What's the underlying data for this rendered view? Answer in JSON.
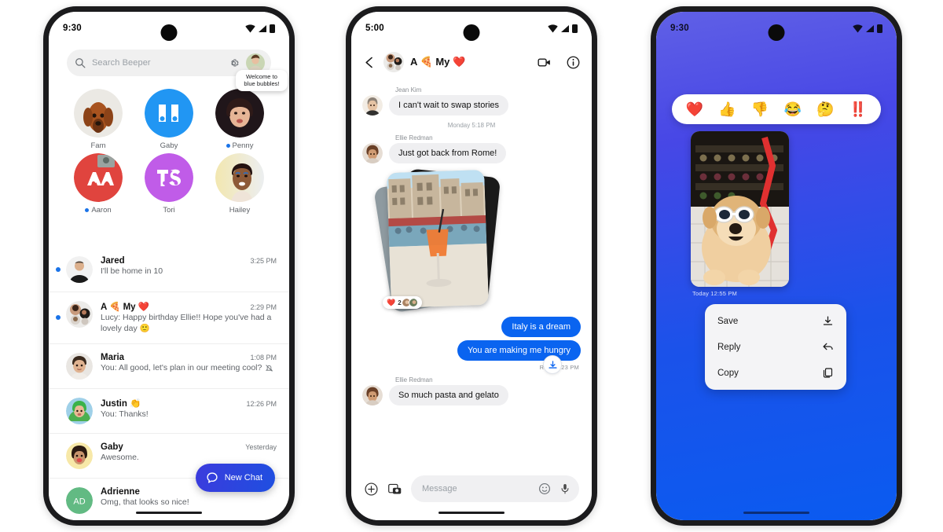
{
  "phone1": {
    "status": {
      "time": "9:30"
    },
    "search": {
      "placeholder": "Search Beeper",
      "icon": "search-icon",
      "settings_icon": "gear-icon"
    },
    "tooltip": "Welcome to blue bubbles!",
    "avatars": [
      {
        "name": "Fam",
        "unread": false
      },
      {
        "name": "Gaby",
        "unread": false
      },
      {
        "name": "Penny",
        "unread": true
      },
      {
        "name": "Aaron",
        "unread": true
      },
      {
        "name": "Tori",
        "unread": false
      },
      {
        "name": "Hailey",
        "unread": false
      }
    ],
    "chats": [
      {
        "name": "Jared",
        "preview": "I'll be home in 10",
        "time": "3:25 PM",
        "unread": true,
        "muted": false
      },
      {
        "name": "A 🍕 My ❤️",
        "preview": "Lucy: Happy birthday Ellie!! Hope you've had a lovely day  🙂",
        "time": "2:29 PM",
        "unread": true,
        "muted": false
      },
      {
        "name": "Maria",
        "preview": "You: All good, let's plan in our meeting cool?",
        "time": "1:08 PM",
        "unread": false,
        "muted": true
      },
      {
        "name": "Justin 👏",
        "preview": "You: Thanks!",
        "time": "12:26 PM",
        "unread": false,
        "muted": false
      },
      {
        "name": "Gaby",
        "preview": "Awesome.",
        "time": "Yesterday",
        "unread": false,
        "muted": false
      },
      {
        "name": "Adrienne",
        "preview": "Omg, that looks so nice!",
        "time": "",
        "unread": false,
        "muted": false,
        "initials": "AD"
      }
    ],
    "new_chat": {
      "label": "New Chat",
      "icon": "chat-bubble-icon",
      "color": "#2b3fe0"
    }
  },
  "phone2": {
    "status": {
      "time": "5:00"
    },
    "header": {
      "back_icon": "back-arrow-icon",
      "title": "A 🍕 My ❤️",
      "video_icon": "video-call-icon",
      "info_icon": "info-icon"
    },
    "messages": [
      {
        "type": "incoming",
        "sender": "Jean Kim",
        "text": "I can't wait to swap stories"
      },
      {
        "type": "daystamp",
        "text": "Monday 5:18 PM"
      },
      {
        "type": "incoming",
        "sender": "Ellie Redman",
        "text": "Just got back from Rome!"
      },
      {
        "type": "photo-stack",
        "reaction": "❤️",
        "reaction_count": "2",
        "download_icon": "download-icon"
      },
      {
        "type": "outgoing",
        "text": "Italy is a dream"
      },
      {
        "type": "outgoing",
        "text": "You are making me hungry",
        "receipt": "Read  5:23 PM"
      },
      {
        "type": "incoming",
        "sender": "Ellie Redman",
        "text": "So much pasta and gelato"
      }
    ],
    "composer": {
      "placeholder": "Message",
      "plus_icon": "plus-circle-icon",
      "gallery_icon": "gallery-icon",
      "emoji_icon": "emoji-icon",
      "mic_icon": "microphone-icon"
    }
  },
  "phone3": {
    "status": {
      "time": "9:30"
    },
    "background_top": "#6060e6",
    "background_bottom": "#0a5bf0",
    "reactions": [
      "❤️",
      "👍",
      "👎",
      "😂",
      "🤔",
      "‼️"
    ],
    "photo_timestamp": "Today  12:55 PM",
    "context_menu": [
      {
        "label": "Save",
        "icon": "download-icon"
      },
      {
        "label": "Reply",
        "icon": "reply-arrow-icon"
      },
      {
        "label": "Copy",
        "icon": "copy-icon"
      }
    ]
  }
}
